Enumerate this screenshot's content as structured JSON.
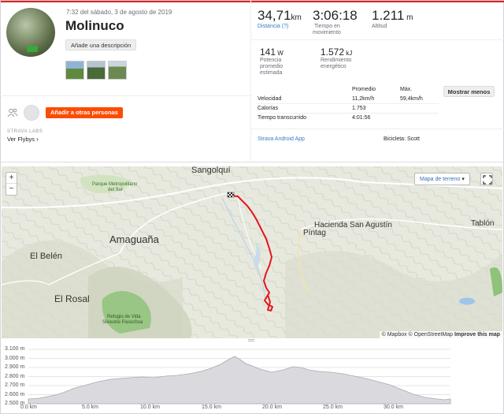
{
  "activity": {
    "datetime": "7:32 del sábado, 3 de agosto de 2019",
    "title": "Molinuco",
    "add_description": "Añade una descripción",
    "add_people": "Añadir a otras personas",
    "labs_label": "STRAVA LABS",
    "flyby": "Ver Flybys",
    "app": "Strava Android App",
    "bike": "Bicicleta: Scott"
  },
  "stats": {
    "distance": {
      "value": "34,71",
      "unit": "km",
      "label": "Distancia (?)"
    },
    "moving_time": {
      "value": "3:06:18",
      "label1": "Tiempo en",
      "label2": "movimiento"
    },
    "elevation": {
      "value": "1.211",
      "unit": "m",
      "label": "Altitud"
    },
    "power": {
      "value": "141",
      "unit": "W",
      "label1": "Potencia",
      "label2": "promedio",
      "label3": "estimada"
    },
    "energy": {
      "value": "1.572",
      "unit": "kJ",
      "label1": "Rendimiento",
      "label2": "energético"
    }
  },
  "table": {
    "col_avg": "Promedio",
    "col_max": "Máx.",
    "show_less": "Mostrar menos",
    "rows": [
      {
        "label": "Velocidad",
        "avg": "11,2km/h",
        "max": "59,4km/h"
      },
      {
        "label": "Calorías",
        "avg": "1.753",
        "max": ""
      },
      {
        "label": "Tiempo transcurrido",
        "avg": "4:01:56",
        "max": ""
      }
    ]
  },
  "map": {
    "zoom_in": "+",
    "zoom_out": "−",
    "map_type": "Mapa de terreno",
    "attribution_a": "© Mapbox © OpenStreetMap",
    "attribution_b": "Improve this map",
    "places": {
      "sangolqui": "Sangolquí",
      "parque": "Parque Metropolitano",
      "parque2": "del Sur",
      "amaguana": "Amaguaña",
      "belen": "El Belén",
      "rosal": "El Rosal",
      "hacienda": "Hacienda San Agustín",
      "pintag": "Píntag",
      "tablon": "Tablón",
      "refugio": "Refugio de Vida",
      "refugio2": "Silvestre Pasochoa"
    }
  },
  "elevation_chart": {
    "y_ticks": [
      "3.100 m",
      "3.000 m",
      "2.900 m",
      "2.800 m",
      "2.700 m",
      "2.600 m",
      "2.500 m"
    ],
    "x_ticks": [
      "0.0 km",
      "5.0 km",
      "10.0 km",
      "15.0 km",
      "20.0 km",
      "25.0 km",
      "30.0 km"
    ]
  },
  "colors": {
    "accent": "#fc4c02",
    "route": "#e8141c",
    "link": "#3a7bc8"
  }
}
